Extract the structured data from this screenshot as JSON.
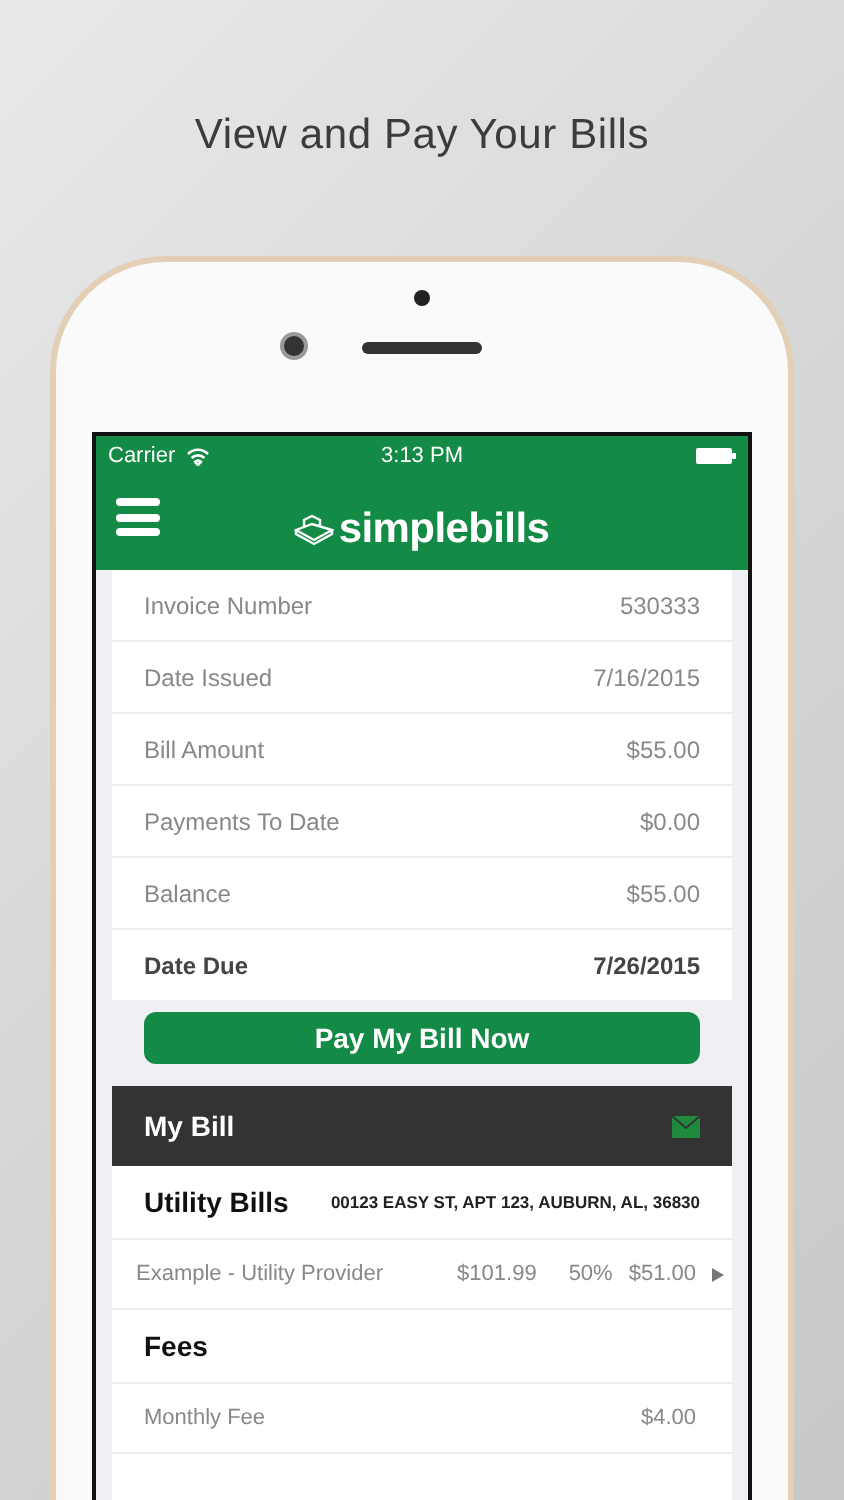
{
  "headline": "View and Pay Your Bills",
  "status_bar": {
    "carrier": "Carrier",
    "time": "3:13 PM"
  },
  "nav_bar": {
    "logo_text": "simplebills"
  },
  "invoice_details": [
    {
      "label": "Invoice Number",
      "value": "530333",
      "emphasized": false
    },
    {
      "label": "Date Issued",
      "value": "7/16/2015",
      "emphasized": false
    },
    {
      "label": "Bill Amount",
      "value": "$55.00",
      "emphasized": false
    },
    {
      "label": "Payments To Date",
      "value": "$0.00",
      "emphasized": false
    },
    {
      "label": "Balance",
      "value": "$55.00",
      "emphasized": false
    },
    {
      "label": "Date Due",
      "value": "7/26/2015",
      "emphasized": true
    }
  ],
  "pay_button": "Pay My Bill Now",
  "my_bill": {
    "title": "My Bill",
    "sections": [
      {
        "title": "Utility Bills",
        "address": "00123 EASY ST, APT 123, AUBURN, AL, 36830",
        "items": [
          {
            "name": "Example - Utility Provider",
            "amount": "$101.99",
            "share": "50%",
            "total": "$51.00"
          }
        ]
      },
      {
        "title": "Fees",
        "items": [
          {
            "name": "Monthly Fee",
            "total": "$4.00"
          }
        ]
      }
    ]
  }
}
